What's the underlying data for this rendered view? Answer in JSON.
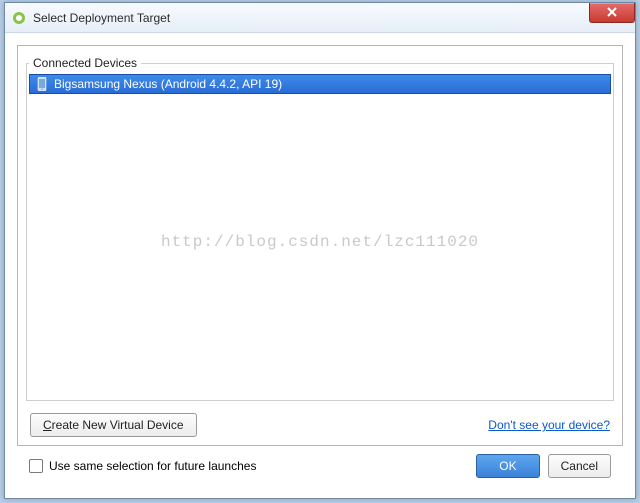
{
  "window": {
    "title": "Select Deployment Target"
  },
  "panel": {
    "group_label": "Connected Devices",
    "devices": [
      {
        "label": "Bigsamsung Nexus (Android 4.4.2, API 19)",
        "selected": true
      }
    ],
    "watermark": "http://blog.csdn.net/lzc111020",
    "create_button": "Create New Virtual Device",
    "help_link": "Don't see your device?"
  },
  "footer": {
    "checkbox_label": "Use same selection for future launches",
    "checkbox_checked": false,
    "ok_label": "OK",
    "cancel_label": "Cancel"
  }
}
